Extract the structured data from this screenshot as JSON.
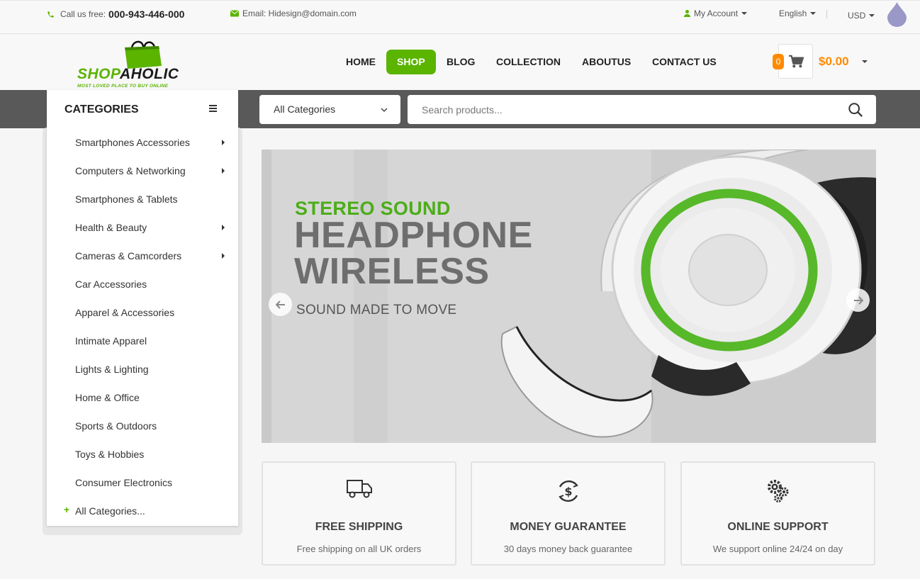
{
  "topbar": {
    "phone_label": "Call us free:",
    "phone_number": "000-943-446-000",
    "email_label": "Email: Hidesign@domain.com",
    "account": "My Account",
    "language": "English",
    "currency": "USD"
  },
  "logo": {
    "word_part1": "SHOP",
    "word_part2": "AHOLIC",
    "tagline": "MOST LOVED PLACE TO BUY ONLINE"
  },
  "nav": {
    "items": [
      {
        "label": "HOME",
        "active": false
      },
      {
        "label": "SHOP",
        "active": true
      },
      {
        "label": "BLOG",
        "active": false
      },
      {
        "label": "COLLECTION",
        "active": false
      },
      {
        "label": "ABOUTUS",
        "active": false
      },
      {
        "label": "CONTACT US",
        "active": false
      }
    ]
  },
  "cart": {
    "count": "0",
    "total": "$0.00"
  },
  "search": {
    "category_selected": "All Categories",
    "placeholder": "Search products..."
  },
  "categories": {
    "title": "CATEGORIES",
    "items": [
      {
        "label": "Smartphones Accessories",
        "has_submenu": true
      },
      {
        "label": "Computers & Networking",
        "has_submenu": true
      },
      {
        "label": "Smartphones & Tablets",
        "has_submenu": false
      },
      {
        "label": "Health & Beauty",
        "has_submenu": true
      },
      {
        "label": "Cameras & Camcorders",
        "has_submenu": true
      },
      {
        "label": "Car Accessories",
        "has_submenu": false
      },
      {
        "label": "Apparel & Accessories",
        "has_submenu": false
      },
      {
        "label": "Intimate Apparel",
        "has_submenu": false
      },
      {
        "label": "Lights & Lighting",
        "has_submenu": false
      },
      {
        "label": "Home & Office",
        "has_submenu": false
      },
      {
        "label": "Sports & Outdoors",
        "has_submenu": false
      },
      {
        "label": "Toys & Hobbies",
        "has_submenu": false
      },
      {
        "label": "Consumer Electronics",
        "has_submenu": false
      }
    ],
    "more": "All Categories..."
  },
  "banner": {
    "line1": "STEREO SOUND",
    "line2": "HEADPHONE",
    "line3": "WIRELESS",
    "line4": "SOUND MADE TO MOVE"
  },
  "features": [
    {
      "icon": "truck-icon",
      "title": "FREE SHIPPING",
      "desc": "Free shipping on all UK orders"
    },
    {
      "icon": "money-back-icon",
      "title": "MONEY GUARANTEE",
      "desc": "30 days money back guarantee"
    },
    {
      "icon": "gears-icon",
      "title": "ONLINE SUPPORT",
      "desc": "We support online 24/24 on day"
    }
  ],
  "colors": {
    "accent": "#5ab400",
    "cart_accent": "#ff8a00",
    "band": "#595959"
  }
}
